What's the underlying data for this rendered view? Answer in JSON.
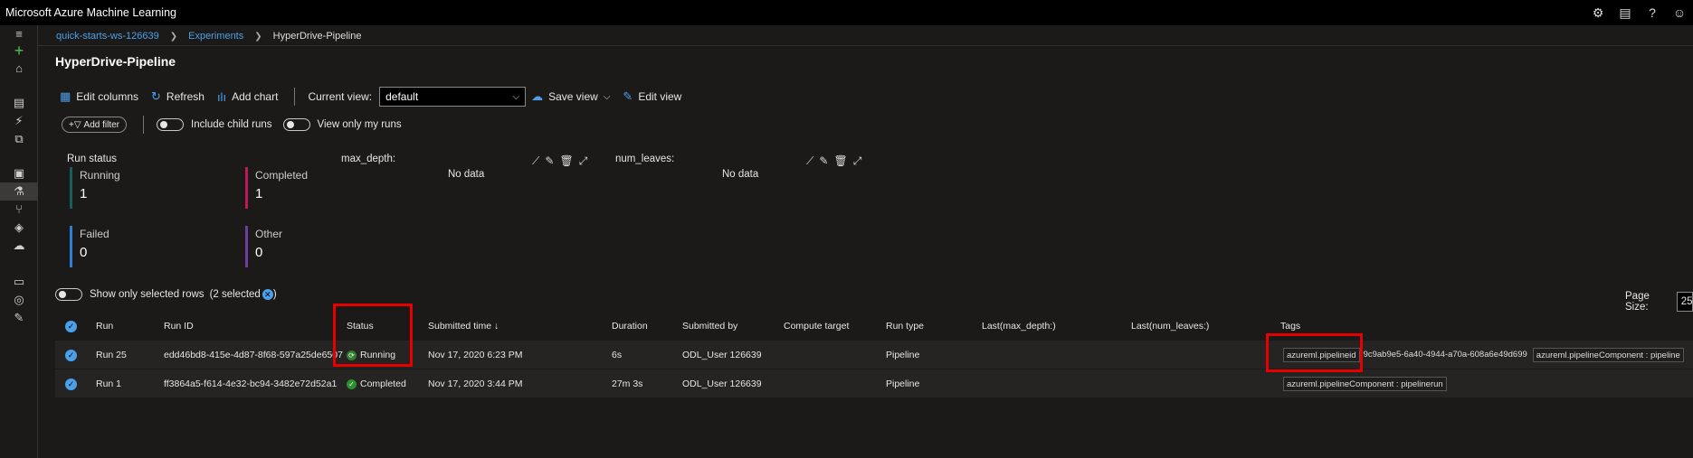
{
  "app": {
    "title": "Microsoft Azure Machine Learning"
  },
  "top_icons": [
    "gear-icon",
    "feedback-icon",
    "help-icon",
    "smiley-icon"
  ],
  "breadcrumb": {
    "workspace": "quick-starts-ws-126639",
    "experiments": "Experiments",
    "current": "HyperDrive-Pipeline"
  },
  "page": {
    "title": "HyperDrive-Pipeline"
  },
  "toolbar": {
    "edit_columns": "Edit columns",
    "refresh": "Refresh",
    "add_chart": "Add chart",
    "current_view_label": "Current view:",
    "current_view_value": "default",
    "save_view": "Save view",
    "edit_view": "Edit view"
  },
  "filters": {
    "add_filter": "Add filter",
    "include_child_runs": "Include child runs",
    "view_only_my_runs": "View only my runs"
  },
  "run_status": {
    "title": "Run status",
    "running": {
      "label": "Running",
      "value": "1",
      "color": "#1b5e5e"
    },
    "completed": {
      "label": "Completed",
      "value": "1",
      "color": "#c2185b"
    },
    "failed": {
      "label": "Failed",
      "value": "0",
      "color": "#2f7ed8"
    },
    "other": {
      "label": "Other",
      "value": "0",
      "color": "#6a3fa0"
    }
  },
  "charts": [
    {
      "title": "max_depth:",
      "message": "No data"
    },
    {
      "title": "num_leaves:",
      "message": "No data"
    }
  ],
  "selection": {
    "label": "Show only selected rows",
    "count": "(2 selected",
    "close": ")"
  },
  "page_size": {
    "label": "Page Size:",
    "value": "25"
  },
  "table": {
    "columns": [
      "Run",
      "Run ID",
      "Status",
      "Submitted time ↓",
      "Duration",
      "Submitted by",
      "Compute target",
      "Run type",
      "Last(max_depth:)",
      "Last(num_leaves:)",
      "Tags"
    ],
    "rows": [
      {
        "run": "Run 25",
        "run_id": "edd46bd8-415e-4d87-8f68-597a25de6507",
        "status": "Running",
        "submitted": "Nov 17, 2020 6:23 PM",
        "duration": "6s",
        "submitted_by": "ODL_User 126639",
        "compute": "",
        "run_type": "Pipeline",
        "tag1": "azureml.pipelineid",
        "tag1_value": "9c9ab9e5-6a40-4944-a70a-608a6e49d699",
        "tag2": "azureml.pipelineComponent : pipeline"
      },
      {
        "run": "Run 1",
        "run_id": "ff3864a5-f614-4e32-bc94-3482e72d52a1",
        "status": "Completed",
        "submitted": "Nov 17, 2020 3:44 PM",
        "duration": "27m 3s",
        "submitted_by": "ODL_User 126639",
        "compute": "",
        "run_type": "Pipeline",
        "tag1": "azureml.pipelineComponent : pipelinerun"
      }
    ]
  },
  "colors": {
    "accent": "#4aa0ea",
    "highlight": "#e60000",
    "running": "#2d7d2d",
    "completed": "#2d8f2d"
  }
}
